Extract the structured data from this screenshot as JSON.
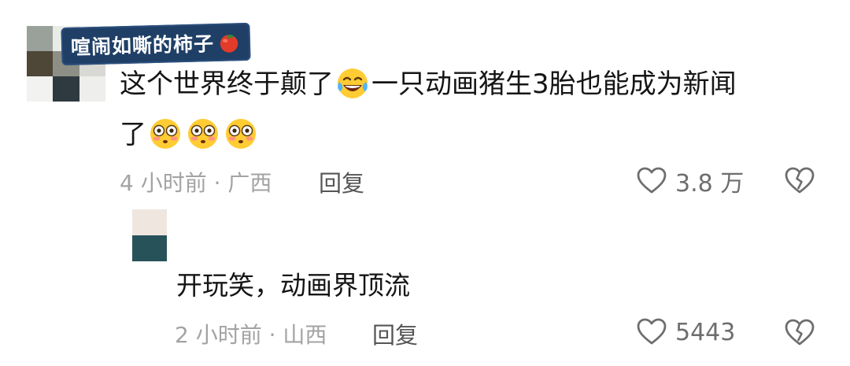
{
  "comment": {
    "username": "喧闹如嘶的柿子",
    "username_icon": "tomato-icon",
    "text_line_1_a": "这个世界终于颠了",
    "text_line_1_emoji": "laughing-crying-emoji",
    "text_line_1_b": "一只动画猪生3胎也能成为新闻",
    "text_line_2": "了",
    "text_line_2_emojis": [
      "flushed-face-emoji",
      "flushed-face-emoji",
      "flushed-face-emoji"
    ],
    "time_location": "4 小时前 · 广西",
    "reply_label": "回复",
    "like_count": "3.8 万",
    "like_icon": "heart-outline-icon",
    "dislike_icon": "broken-heart-icon",
    "avatar_colors": [
      "#9aa09a",
      "#e9ebe6",
      "#f4f4f2",
      "#4e4637",
      "#8d8f86",
      "#d8d9d4",
      "#f2f2f0",
      "#2f3a40",
      "#eeeeec"
    ]
  },
  "reply": {
    "text": "开玩笑，动画界顶流",
    "time_location": "2 小时前 · 山西",
    "reply_label": "回复",
    "like_count": "5443",
    "like_icon": "heart-outline-icon",
    "dislike_icon": "broken-heart-icon",
    "avatar_colors": [
      "#f0e6e0",
      "#27525a"
    ]
  },
  "colors": {
    "username_tag_bg": "#1f3f66",
    "meta_text": "#a3a3a3",
    "reply_link": "#555555",
    "icon_stroke": "#6e6e6e"
  }
}
